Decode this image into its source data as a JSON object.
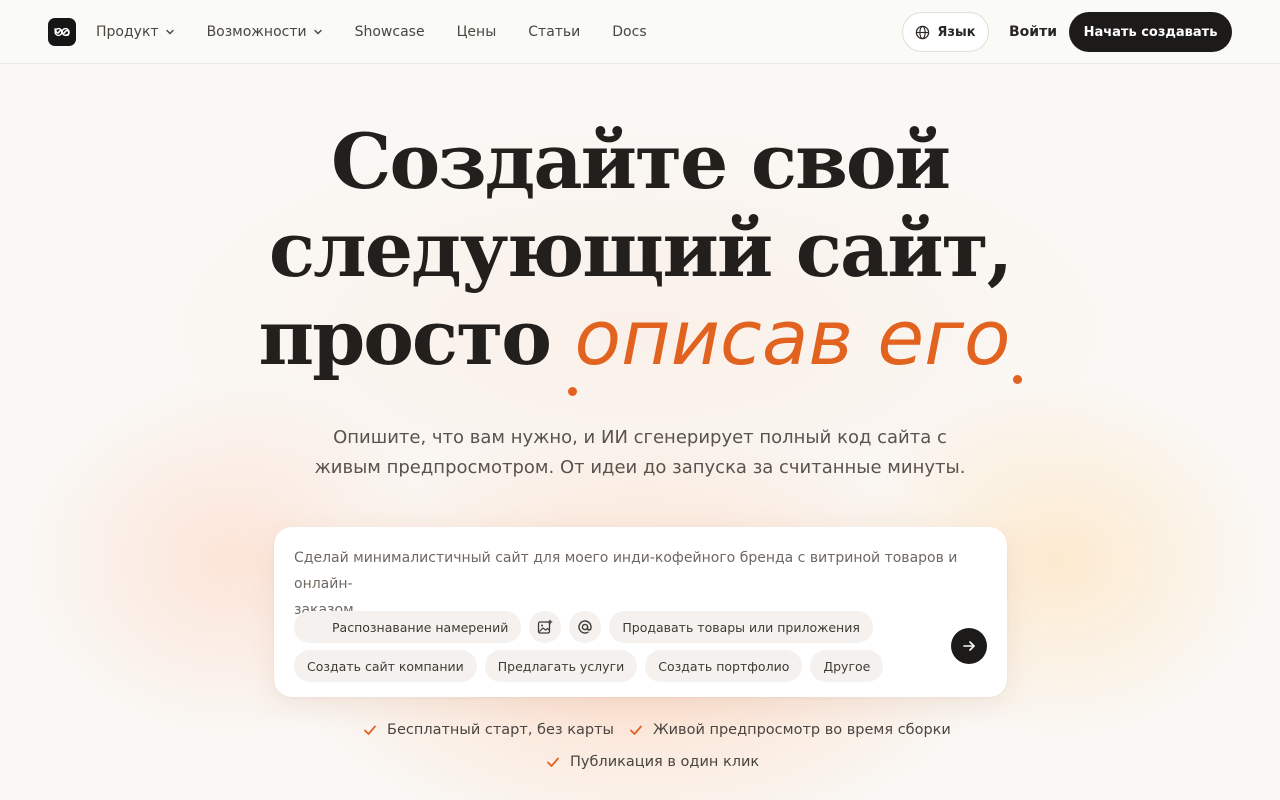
{
  "header": {
    "nav": [
      {
        "label": "Продукт",
        "has_dropdown": true
      },
      {
        "label": "Возможности",
        "has_dropdown": true
      },
      {
        "label": "Showcase",
        "has_dropdown": false
      },
      {
        "label": "Цены",
        "has_dropdown": false
      },
      {
        "label": "Статьи",
        "has_dropdown": false
      },
      {
        "label": "Docs",
        "has_dropdown": false
      }
    ],
    "language_label": "Язык",
    "login_label": "Войти",
    "cta_label": "Начать создавать"
  },
  "hero": {
    "title_line1": "Создайте свой",
    "title_line2": "следующий сайт,",
    "title_line3_plain": "просто",
    "title_line3_accent": "описав его",
    "subtitle_line1": "Опишите, что вам нужно, и ИИ сгенерирует полный код сайта с",
    "subtitle_line2": "живым предпросмотром. От идеи до запуска за считанные минуты."
  },
  "prompt": {
    "placeholder_line1": "Сделай минималистичный сайт для моего инди-кофейного бренда с витриной товаров и онлайн-",
    "placeholder_line2": "заказом...",
    "chips_row1": [
      "Распознавание намерений",
      "Продавать товары или приложения"
    ],
    "chips_row2": [
      "Создать сайт компании",
      "Предлагать услуги",
      "Создать портфолио",
      "Другое"
    ]
  },
  "features": [
    "Бесплатный старт, без карты",
    "Живой предпросмотр во время сборки",
    "Публикация в один клик"
  ],
  "colors": {
    "accent": "#e2621f",
    "dark": "#1d1b1a",
    "background": "#faf8f5"
  }
}
